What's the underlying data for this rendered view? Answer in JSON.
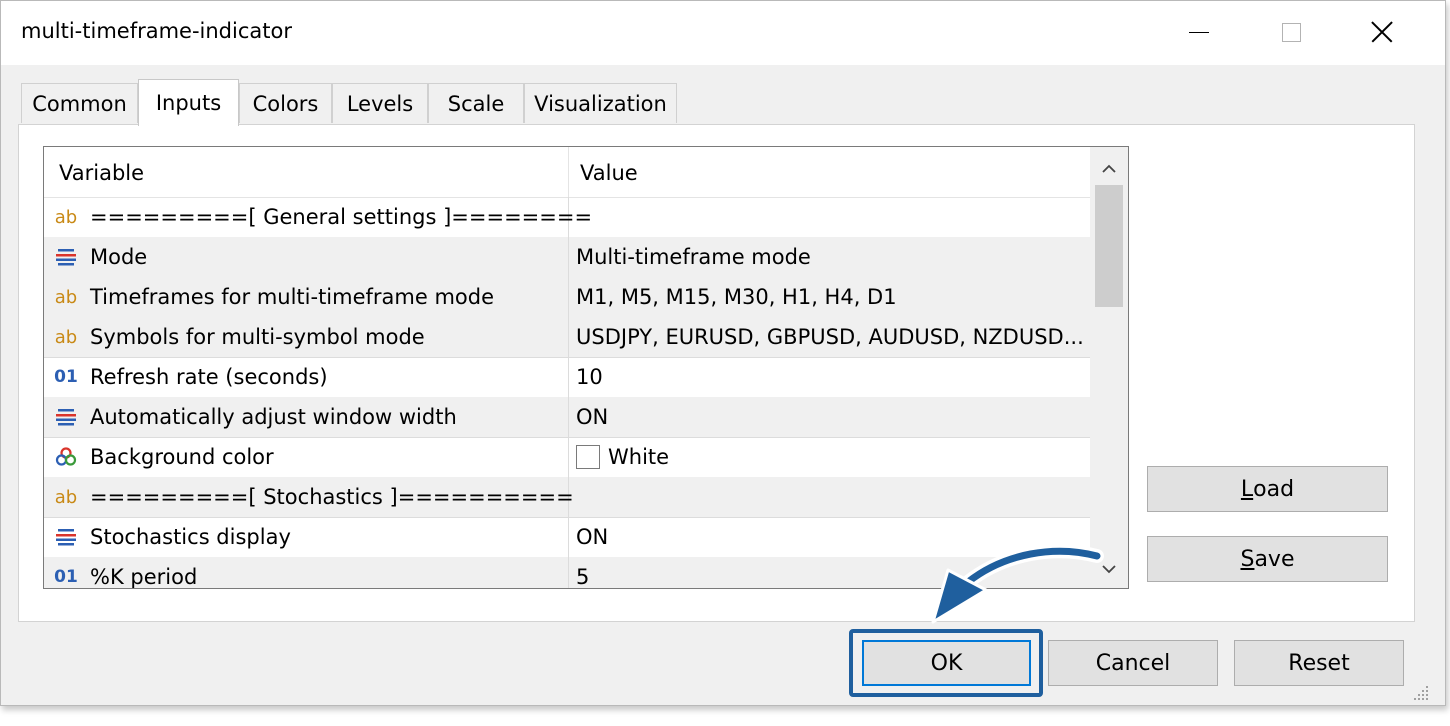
{
  "window": {
    "title": "multi-timeframe-indicator",
    "controls": [
      "minimize-icon",
      "maximize-icon",
      "close-icon"
    ]
  },
  "tabs": [
    {
      "label": "Common"
    },
    {
      "label": "Inputs",
      "active": true
    },
    {
      "label": "Colors"
    },
    {
      "label": "Levels"
    },
    {
      "label": "Scale"
    },
    {
      "label": "Visualization"
    }
  ],
  "grid": {
    "headers": {
      "variable": "Variable",
      "value": "Value"
    },
    "rows": [
      {
        "icon": "string-icon",
        "variable": "=========[ General settings ]========",
        "value": ""
      },
      {
        "icon": "enum-icon",
        "variable": "Mode",
        "value": "Multi-timeframe mode"
      },
      {
        "icon": "string-icon",
        "variable": "Timeframes for multi-timeframe mode",
        "value": "M1, M5, M15, M30, H1, H4, D1"
      },
      {
        "icon": "string-icon",
        "variable": "Symbols for multi-symbol mode",
        "value": "USDJPY, EURUSD, GBPUSD, AUDUSD, NZDUSD..."
      },
      {
        "icon": "integer-icon",
        "variable": "Refresh rate (seconds)",
        "value": "10"
      },
      {
        "icon": "enum-icon",
        "variable": "Automatically adjust window width",
        "value": "ON"
      },
      {
        "icon": "color-icon",
        "variable": "Background color",
        "value": "White",
        "swatch": "#ffffff"
      },
      {
        "icon": "string-icon",
        "variable": "=========[ Stochastics ]==========",
        "value": ""
      },
      {
        "icon": "enum-icon",
        "variable": "Stochastics display",
        "value": "ON"
      },
      {
        "icon": "integer-icon",
        "variable": "%K period",
        "value": "5"
      }
    ]
  },
  "icons": {
    "string": "ab",
    "integer": "01"
  },
  "side_buttons": {
    "load": {
      "accel": "L",
      "rest": "oad"
    },
    "save": {
      "accel": "S",
      "rest": "ave"
    }
  },
  "footer_buttons": {
    "ok": "OK",
    "cancel": "Cancel",
    "reset": "Reset"
  },
  "colors": {
    "highlight": "#1f5f9e",
    "arrow": "#1f5f9e",
    "ab_icon": "#c98a17",
    "num_icon": "#2c5fb3"
  }
}
